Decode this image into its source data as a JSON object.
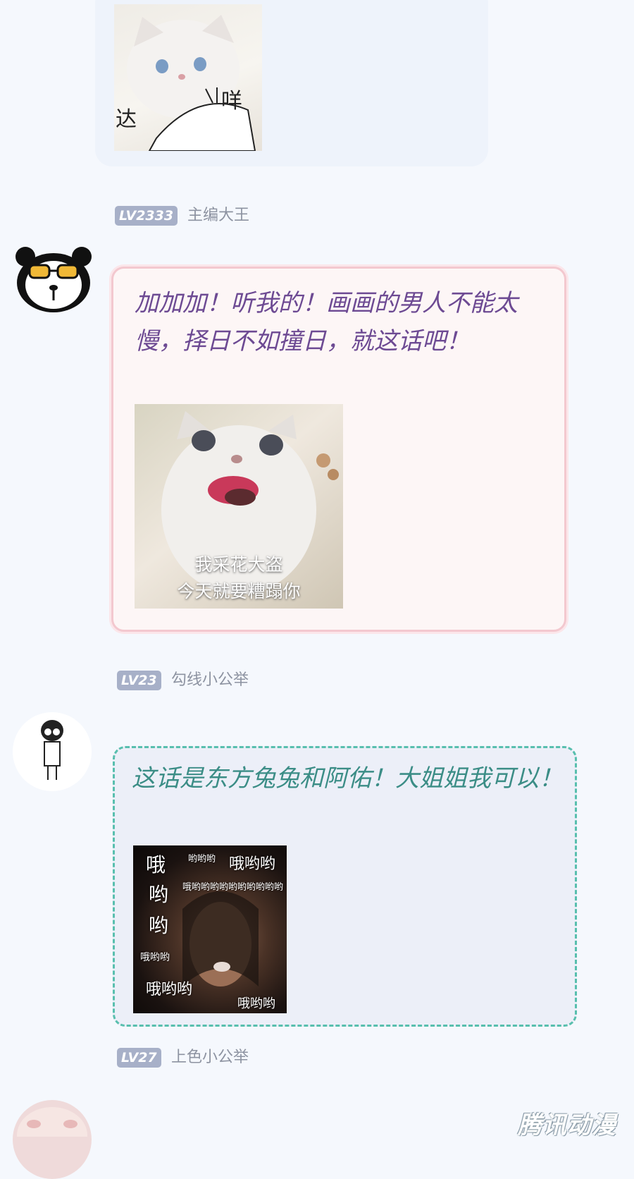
{
  "posts": [
    {
      "sticker_words": [
        "达",
        "咩"
      ]
    },
    {
      "level": "LV2333",
      "username": "主编大王",
      "message": "加加加！听我的！画画的男人不能太慢，择日不如撞日，就这话吧！",
      "image_caption": [
        "我采花大盗",
        "今天就要糟蹋你"
      ]
    },
    {
      "level": "LV23",
      "username": "勾线小公举",
      "message": "这话是东方兔兔和阿佑！大姐姐我可以！",
      "meme_words": [
        "哦",
        "哟哟哟",
        "哦哟哟",
        "哟",
        "哦哟哟哟哟哟哟哟哟哟哟",
        "哟",
        "哦哟哟",
        "哦哟哟",
        "哦哟哟"
      ]
    },
    {
      "level": "LV27",
      "username": "上色小公举"
    }
  ],
  "watermark": "腾讯动漫",
  "colors": {
    "background": "#f5f8fd",
    "level_tag": "#a7b0c8",
    "msg1_text": "#6d4a93",
    "msg1_border": "#f3c8cf",
    "msg2_text": "#3b8d86",
    "msg2_border": "#58bfae"
  }
}
